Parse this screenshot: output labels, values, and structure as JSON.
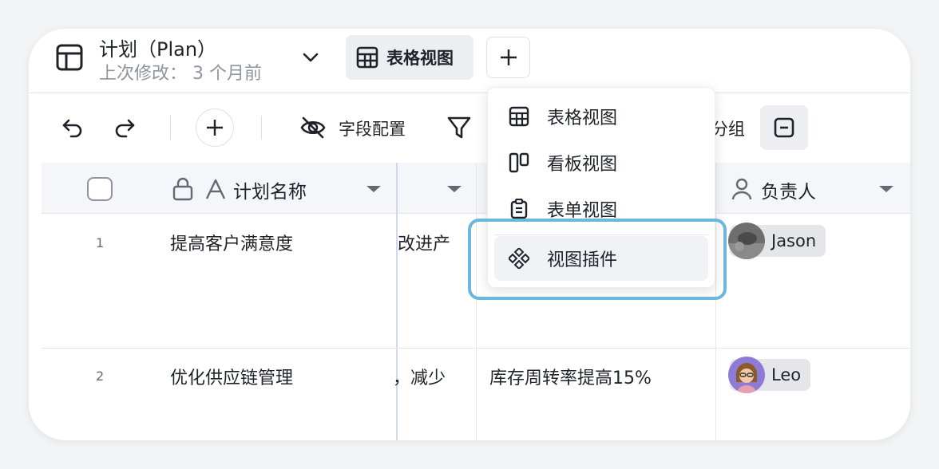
{
  "header": {
    "title": "计划（Plan）",
    "subtitle": "上次修改： 3 个月前",
    "active_view_tab": "表格视图"
  },
  "toolbar": {
    "field_config_label": "字段配置",
    "group_label_partial": "分组"
  },
  "grid": {
    "columns": [
      {
        "name": "计划名称"
      },
      {
        "name": ""
      },
      {
        "name": ""
      },
      {
        "name": "负责人"
      }
    ],
    "rows": [
      {
        "num": "1",
        "plan_name": "提高客户满意度",
        "col2": "改进产",
        "col3": "",
        "owner": "Jason"
      },
      {
        "num": "2",
        "plan_name": "优化供应链管理",
        "col2": "，减少",
        "col3": "库存周转率提高15%",
        "owner": "Leo"
      }
    ]
  },
  "view_menu": {
    "items": [
      {
        "label": "表格视图",
        "icon": "grid-icon"
      },
      {
        "label": "看板视图",
        "icon": "kanban-icon"
      },
      {
        "label": "表单视图",
        "icon": "form-icon"
      },
      {
        "label": "视图插件",
        "icon": "plugin-icon"
      }
    ]
  },
  "colors": {
    "accent_highlight": "#6bb8dc",
    "header_bg": "#f4f6fa",
    "tab_bg": "#eceef1"
  }
}
